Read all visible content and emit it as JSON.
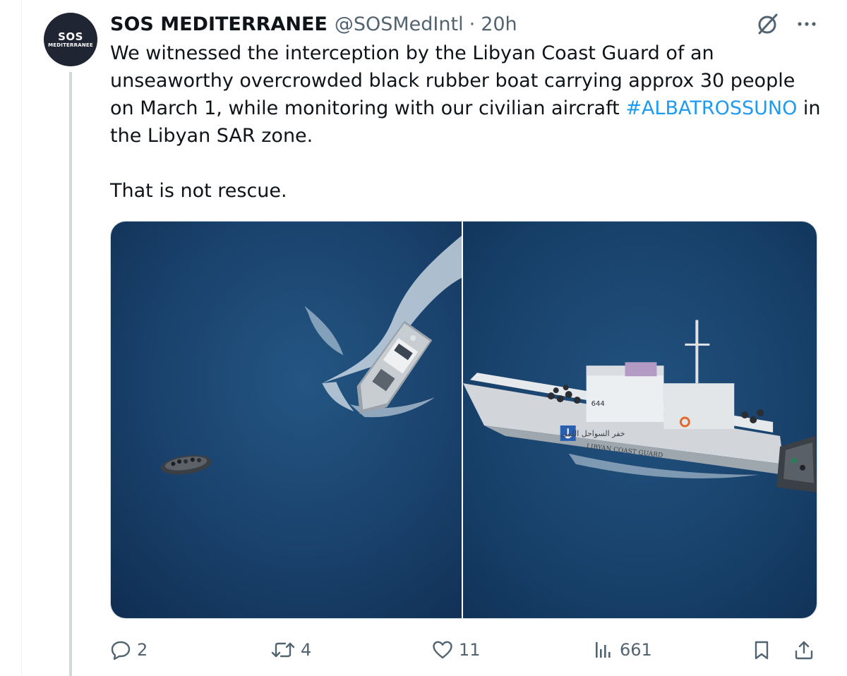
{
  "tweet": {
    "author": {
      "display_name": "SOS MEDITERRANEE",
      "handle": "@SOSMedIntl",
      "avatar": {
        "line1": "SOS",
        "line2": "MEDITERRANEE"
      }
    },
    "time": "20h",
    "separator": "·",
    "text": {
      "part1": "We witnessed the interception by the Libyan Coast Guard of an unseaworthy overcrowded black rubber boat carrying approx 30 people on March 1, while monitoring with our civilian aircraft ",
      "hashtag": "#ALBATROSSUNO",
      "part2": " in the Libyan SAR zone.",
      "line2": "That is not rescue."
    },
    "media": {
      "right_photo": {
        "vessel_number": "644",
        "vessel_name": "LIBYAN COAST GUARD",
        "arabic_name": "خفر السواحل الليبي"
      }
    },
    "actions": {
      "replies": "2",
      "reposts": "4",
      "likes": "11",
      "views": "661"
    }
  },
  "icons": {
    "top": [
      "grok-icon",
      "more-icon"
    ],
    "bottom": [
      "reply-icon",
      "repost-icon",
      "like-icon",
      "views-icon",
      "bookmark-icon",
      "share-icon"
    ]
  },
  "colors": {
    "text": "#0f1419",
    "secondary": "#536471",
    "link": "#1d9bf0",
    "avatar_bg": "#1f2533",
    "thread_line": "#cfd9de",
    "sea": "#173f68"
  }
}
